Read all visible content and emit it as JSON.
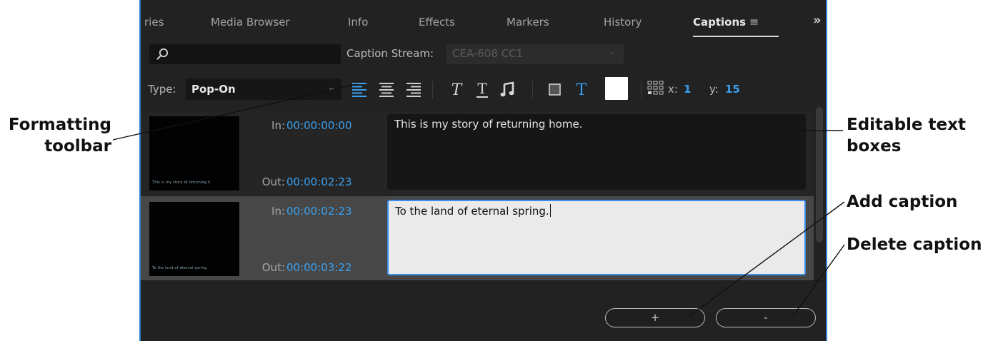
{
  "callouts": {
    "formatting": [
      "Formatting",
      "toolbar"
    ],
    "editable": [
      "Editable text",
      "boxes"
    ],
    "add": "Add caption",
    "delete": "Delete caption"
  },
  "tabs": [
    {
      "label": "ries",
      "active": false
    },
    {
      "label": "Media Browser",
      "active": false
    },
    {
      "label": "Info",
      "active": false
    },
    {
      "label": "Effects",
      "active": false
    },
    {
      "label": "Markers",
      "active": false
    },
    {
      "label": "History",
      "active": false
    },
    {
      "label": "Captions",
      "active": true
    }
  ],
  "panel_menu_icon": "hamburger-icon",
  "overflow_label": "»",
  "search": {
    "value": "",
    "icon": "search-icon"
  },
  "caption_stream": {
    "label": "Caption Stream:",
    "value": "CEA-608 CC1"
  },
  "type": {
    "label": "Type:",
    "value": "Pop-On"
  },
  "toolbar": {
    "buttons": [
      "align-left-icon",
      "align-center-icon",
      "align-right-icon",
      "italic-icon",
      "underline-icon",
      "music-note-icon",
      "background-color-icon",
      "text-color-icon",
      "position-grid-icon"
    ],
    "x_label": "x:",
    "x_value": "1",
    "y_label": "y:",
    "y_value": "15"
  },
  "captions": [
    {
      "in_label": "In:",
      "in": "00:00:00:00",
      "out_label": "Out:",
      "out": "00:00:02:23",
      "text": "This is my story of returning home.",
      "thumb_text": "This is my story of returning h."
    },
    {
      "in_label": "In:",
      "in": "00:00:02:23",
      "out_label": "Out:",
      "out": "00:00:03:22",
      "text": "To the land of eternal spring.",
      "thumb_text": "To the land of eternal spring."
    }
  ],
  "buttons": {
    "add": "+",
    "delete": "-"
  },
  "colors": {
    "panel_bg": "#222222",
    "accent_blue": "#3aa0ef",
    "selected_box_border": "#3a8fe6",
    "panel_border": "#2f7fd0"
  }
}
